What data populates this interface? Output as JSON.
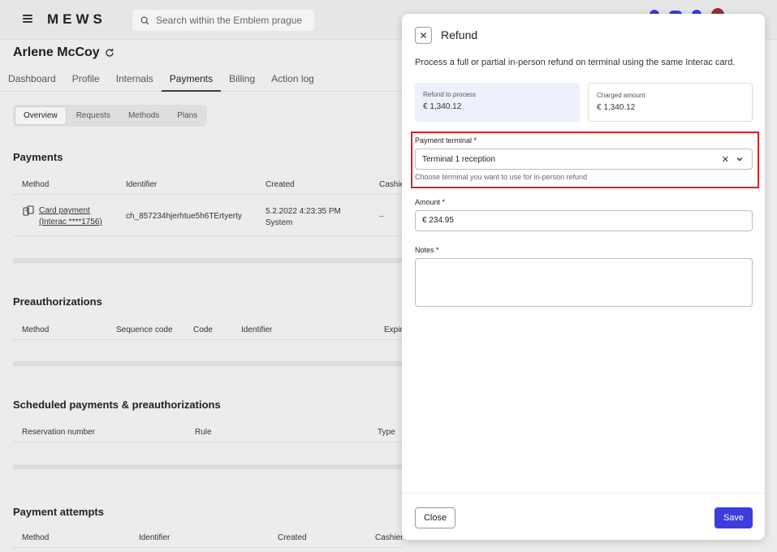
{
  "app": {
    "logo": "MEWS",
    "search_placeholder": "Search within the Emblem prague",
    "guest_name": "Arlene McCoy"
  },
  "tabs": [
    "Dashboard",
    "Profile",
    "Internals",
    "Payments",
    "Billing",
    "Action log"
  ],
  "active_tab": "Payments",
  "subtabs": [
    "Overview",
    "Requests",
    "Methods",
    "Plans"
  ],
  "active_subtab": "Overview",
  "payments": {
    "title": "Payments",
    "columns": [
      "Method",
      "Identifier",
      "Created",
      "Cashie"
    ],
    "row": {
      "method_line1": "Card payment",
      "method_line2": "(Interac ****1756)",
      "identifier": "ch_857234hjerhtue5h6TErtyerty",
      "created_line1": "5.2.2022 4:23:35 PM",
      "created_line2": "System",
      "cashier": "–"
    }
  },
  "preauthorizations": {
    "title": "Preauthorizations",
    "columns": [
      "Method",
      "Sequence code",
      "Code",
      "Identifier",
      "Expir"
    ]
  },
  "scheduled": {
    "title": "Scheduled payments & preauthorizations",
    "columns": [
      "Reservation number",
      "Rule",
      "Type"
    ]
  },
  "attempts": {
    "title": "Payment  attempts",
    "columns": [
      "Method",
      "Identifier",
      "Created",
      "Cashier"
    ]
  },
  "refund_panel": {
    "title": "Refund",
    "description": "Process a full or partial in-person refund on terminal using the same Interac card.",
    "refund_to_process_label": "Refund to process",
    "refund_to_process_value": "€ 1,340.12",
    "charged_amount_label": "Charged amount",
    "charged_amount_value": "€ 1,340.12",
    "terminal_label": "Payment terminal *",
    "terminal_value": "Terminal 1 reception",
    "terminal_hint": "Choose terminal you want to use for in-person refund",
    "amount_label": "Amount *",
    "amount_value": "€ 234.95",
    "notes_label": "Notes *",
    "notes_value": "",
    "close_button": "Close",
    "save_button": "Save"
  },
  "colors": {
    "primary": "#3c3cdf",
    "highlight": "#e02020",
    "refund_card_bg": "#eef0fb"
  }
}
